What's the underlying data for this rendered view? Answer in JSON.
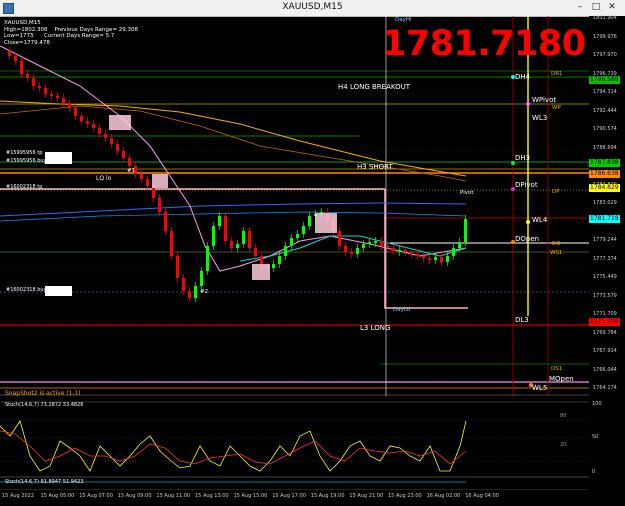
{
  "window": {
    "title": "XAUUSD,M15"
  },
  "header": {
    "symbol": "XAUUSD,M15",
    "high": "High=1802.308",
    "low": "Low=1773",
    "close": "Close=1779.478",
    "prev_range": "Previous Days Range= 29.308",
    "cur_range": "Current Days Range= 5.7",
    "big_price": "1781.7180"
  },
  "levels": {
    "h4": "H4 LONG BREAKOUT",
    "h3": "H3 SHORT",
    "l3": "L3 LONG",
    "lq": "LQ lo",
    "dayhi": "DayHi",
    "daylo": "DayLo",
    "dh4": "DH4",
    "dr1": "DR1",
    "wpivot": "WPivot",
    "wp": "WP",
    "wl3": "WL3",
    "dh3": "DH3",
    "dpivot": "DPivot",
    "dp": "DP",
    "pivot": "Pivot",
    "wl4": "WL4",
    "dopen": "DOpen",
    "do": "DO",
    "ws1": "WS1",
    "dl3": "DL3",
    "ds1": "DS1",
    "mopen": "MOpen",
    "wl5": "WL5",
    "n1": "#1",
    "n2": "#2",
    "ord1": "#15995956 tp",
    "ord2": "#15995956 buy",
    "ord3": "#16002318 tp",
    "ord4": "#16002318 buy"
  },
  "snapshot": "SnapShot2 is active (1,1)",
  "stoch1": "Stoch(14,6,7) 73.2872 33.4826",
  "stoch2": "Stoch(14,6,7) 91.8947 51.9423",
  "price_scale": [
    "1801.904",
    "1799.976",
    "1797.970",
    "1796.739",
    "1794.314",
    "1792.444",
    "1790.574",
    "1788.694",
    "1786.638",
    "1784.829",
    "1783.029",
    "1781.114",
    "1779.244",
    "1777.374",
    "1775.449",
    "1773.579",
    "1771.709",
    "1769.784",
    "1767.914",
    "1766.044",
    "1764.174"
  ],
  "price_tags": [
    {
      "text": "1796.589",
      "color": "#00c000"
    },
    {
      "text": "1787.838",
      "color": "#00d000"
    },
    {
      "text": "1786.638",
      "color": "#ff8c00"
    },
    {
      "text": "1784.829",
      "color": "#ffff00"
    },
    {
      "text": "1781.718",
      "color": "#00ffff"
    },
    {
      "text": "1771.709",
      "color": "#ff0000"
    }
  ],
  "osc_scale": [
    "100",
    "50",
    "0"
  ],
  "osc_labels": [
    "80",
    "20"
  ],
  "time_labels": [
    "15 Aug 2022",
    "15 Aug 05:00",
    "15 Aug 07:00",
    "15 Aug 09:00",
    "15 Aug 11:00",
    "15 Aug 13:00",
    "15 Aug 15:00",
    "15 Aug 17:00",
    "15 Aug 19:00",
    "15 Aug 21:00",
    "15 Aug 23:00",
    "16 Aug 02:00",
    "16 Aug 04:00"
  ],
  "colors": {
    "bull": "#00ff00",
    "bear": "#ff0000",
    "big_price": "#ff0000"
  }
}
